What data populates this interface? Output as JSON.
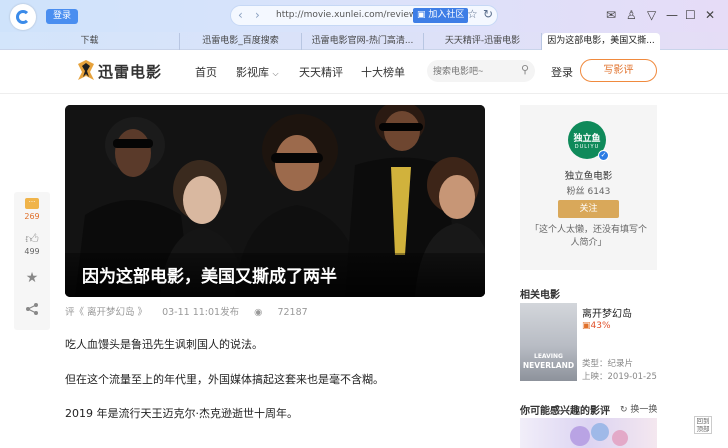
{
  "browser": {
    "login_label": "登录",
    "url": "http://movie.xunlei.com/reviews/",
    "add_community_label": "加入社区",
    "tabs": [
      {
        "label": "下载"
      },
      {
        "label": "迅雷电影_百度搜索"
      },
      {
        "label": "迅雷电影官网-热门高清..."
      },
      {
        "label": "天天精评-迅雷电影"
      },
      {
        "label": "因为这部电影，美国又撕..."
      }
    ]
  },
  "site": {
    "brand": "迅雷电影",
    "nav": [
      {
        "label": "首页"
      },
      {
        "label": "影视库"
      },
      {
        "label": "天天精评"
      },
      {
        "label": "十大榜单"
      }
    ],
    "search_placeholder": "搜索电影吧~",
    "login_label": "登录",
    "write_review_label": "写影评"
  },
  "floatbar": {
    "comments": "269",
    "likes": "499"
  },
  "article": {
    "title": "因为这部电影，美国又撕成了两半",
    "meta": {
      "movie_ref": "评《 离开梦幻岛 》",
      "published": "03-11 11:01发布",
      "views": "72187"
    },
    "paragraphs": [
      "吃人血馒头是鲁迅先生讽刺国人的说法。",
      "但在这个流量至上的年代里，外国媒体搞起这套来也是毫不含糊。",
      "2019 年是流行天王迈克尔·杰克逊逝世十周年。"
    ]
  },
  "author": {
    "avatar_text_cn": "独立鱼",
    "avatar_text_en": "DULIYU",
    "name": "独立鱼电影",
    "fans": "粉丝 6143",
    "follow_label": "关注",
    "desc": "「这个人太懒，还没有填写个人简介」"
  },
  "related": {
    "title": "相关电影",
    "movie": {
      "name": "离开梦幻岛",
      "rating": "43%",
      "poster_text_top": "LEAVING",
      "poster_text_bottom": "NEVERLAND",
      "type": "类型：纪录片",
      "release": "上映：2019-01-25"
    }
  },
  "recommend": {
    "title": "你可能感兴趣的影评",
    "refresh_label": "换一换"
  },
  "scroll_top_label": "回到顶部"
}
